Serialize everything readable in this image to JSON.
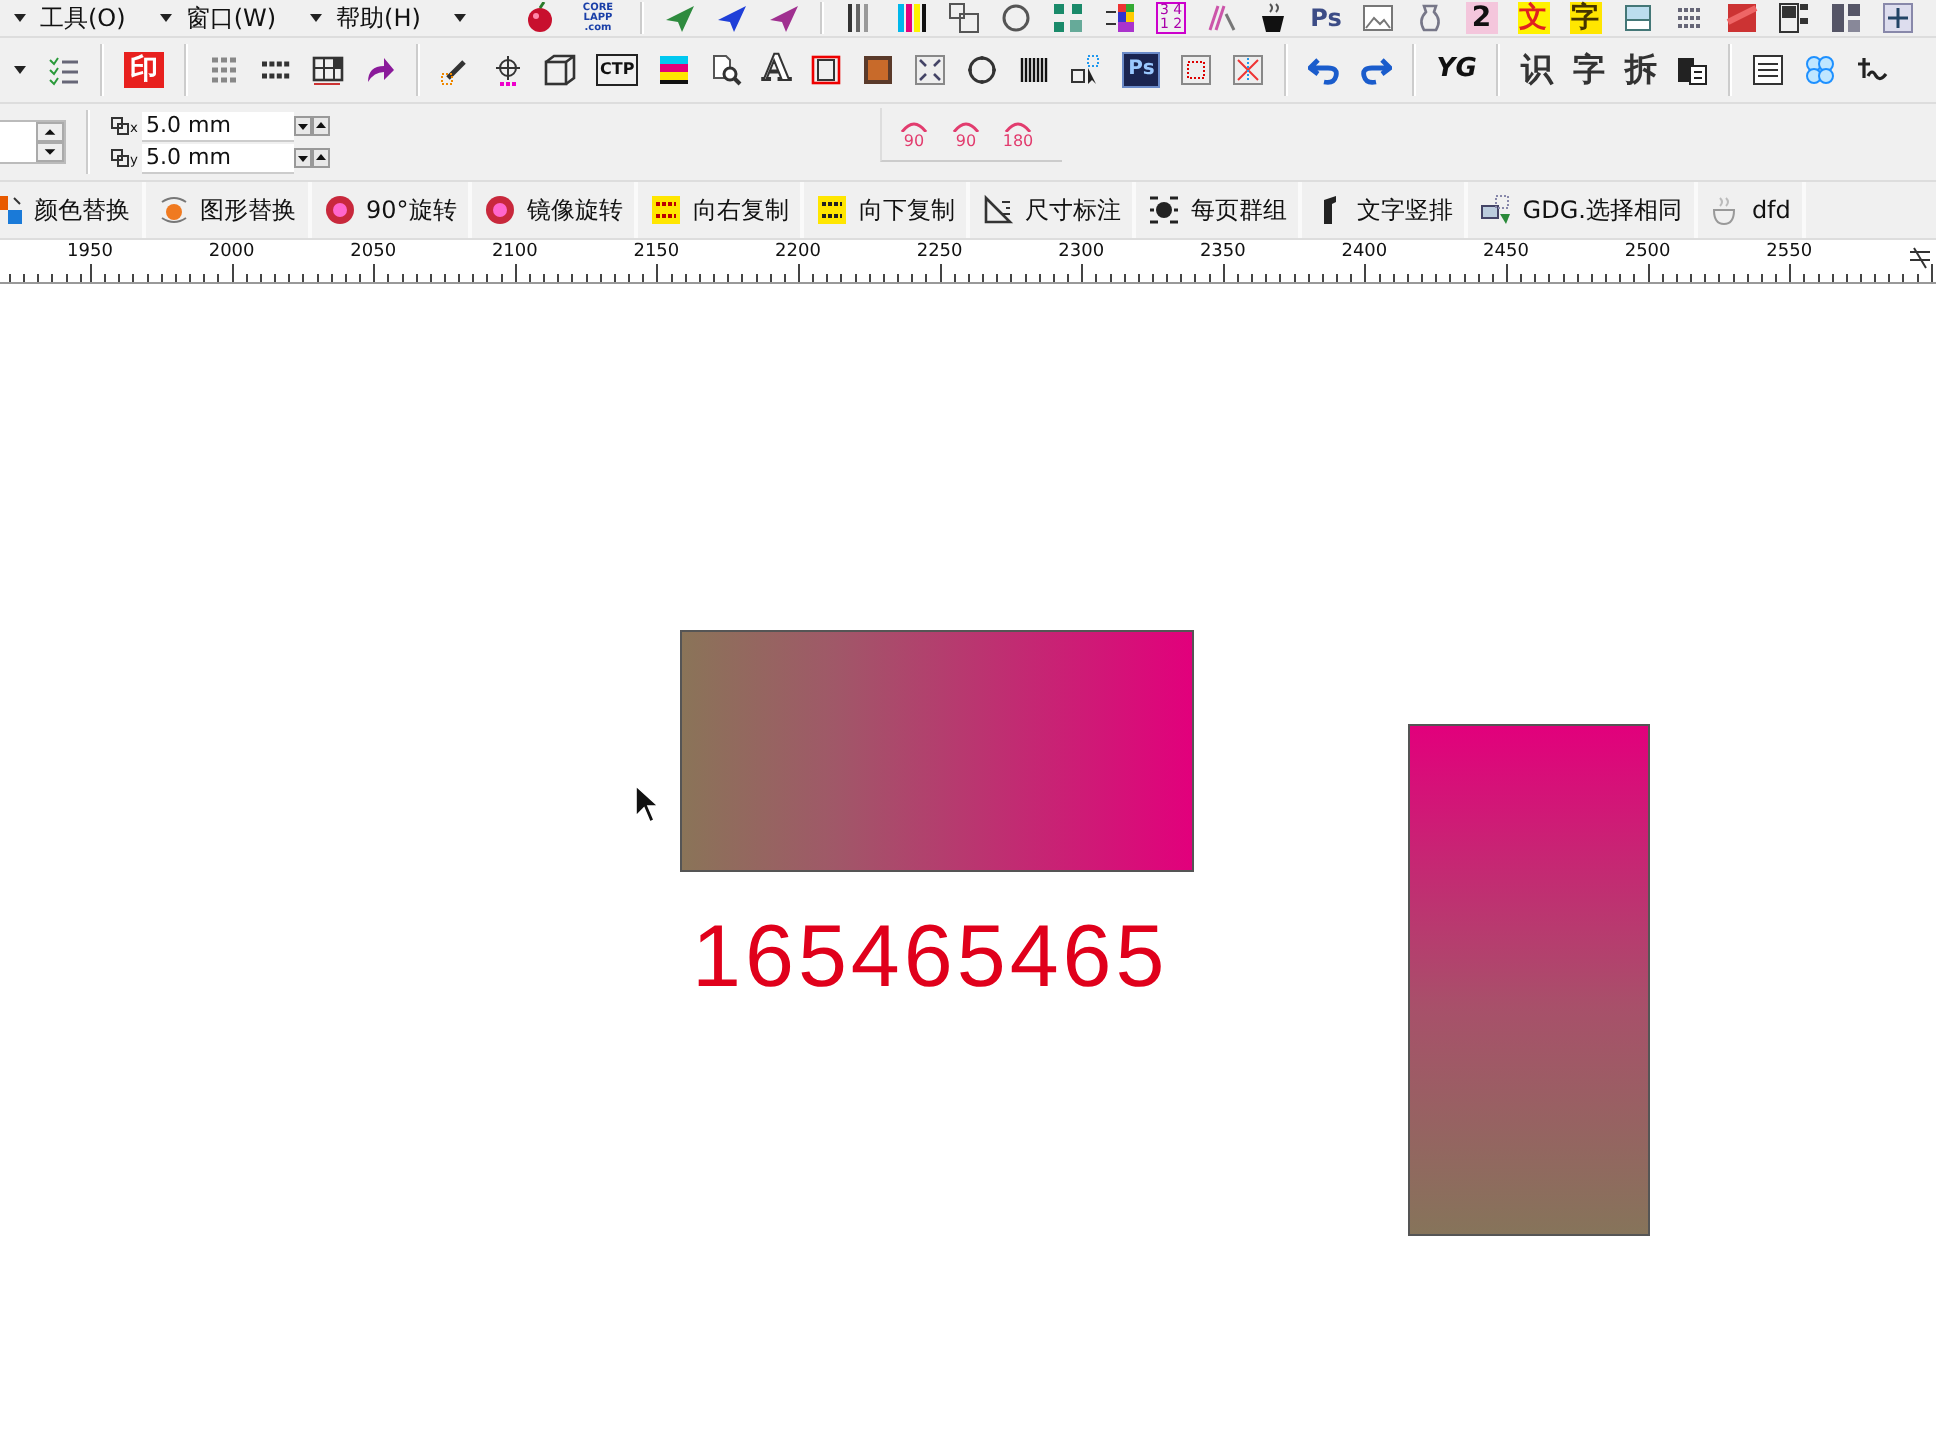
{
  "menu": [
    {
      "label": "工具(O)"
    },
    {
      "label": "窗口(W)"
    },
    {
      "label": "帮助(H)"
    }
  ],
  "top_toolbar": {
    "logo_text": [
      "CORE",
      "LAPP",
      ".com"
    ],
    "labels": [
      "3 4",
      "1 2",
      "Ps",
      "2",
      "文",
      "字"
    ]
  },
  "main_toolbar": {
    "labels": [
      "印",
      "CTP",
      "A",
      "Ps",
      "YG",
      "识",
      "字",
      "拆"
    ]
  },
  "offset_fields": [
    {
      "axis": "x",
      "value": "5.0 mm"
    },
    {
      "axis": "y",
      "value": "5.0 mm"
    }
  ],
  "rotate_buttons": [
    {
      "label": "90"
    },
    {
      "label": "90"
    },
    {
      "label": "180"
    }
  ],
  "macro_buttons": [
    {
      "label": "颜色替换"
    },
    {
      "label": "图形替换"
    },
    {
      "label": "90°旋转"
    },
    {
      "label": "镜像旋转"
    },
    {
      "label": "向右复制"
    },
    {
      "label": "向下复制"
    },
    {
      "label": "尺寸标注"
    },
    {
      "label": "每页群组"
    },
    {
      "label": "文字竖排"
    },
    {
      "label": "GDG.选择相同"
    },
    {
      "label": "dfd"
    }
  ],
  "ruler": {
    "labels": [
      "1950",
      "2000",
      "2050",
      "2100",
      "2150",
      "2200",
      "2250",
      "2300",
      "2350",
      "2400",
      "2450",
      "2500",
      "2550"
    ]
  },
  "canvas": {
    "number_text": "165465465"
  }
}
